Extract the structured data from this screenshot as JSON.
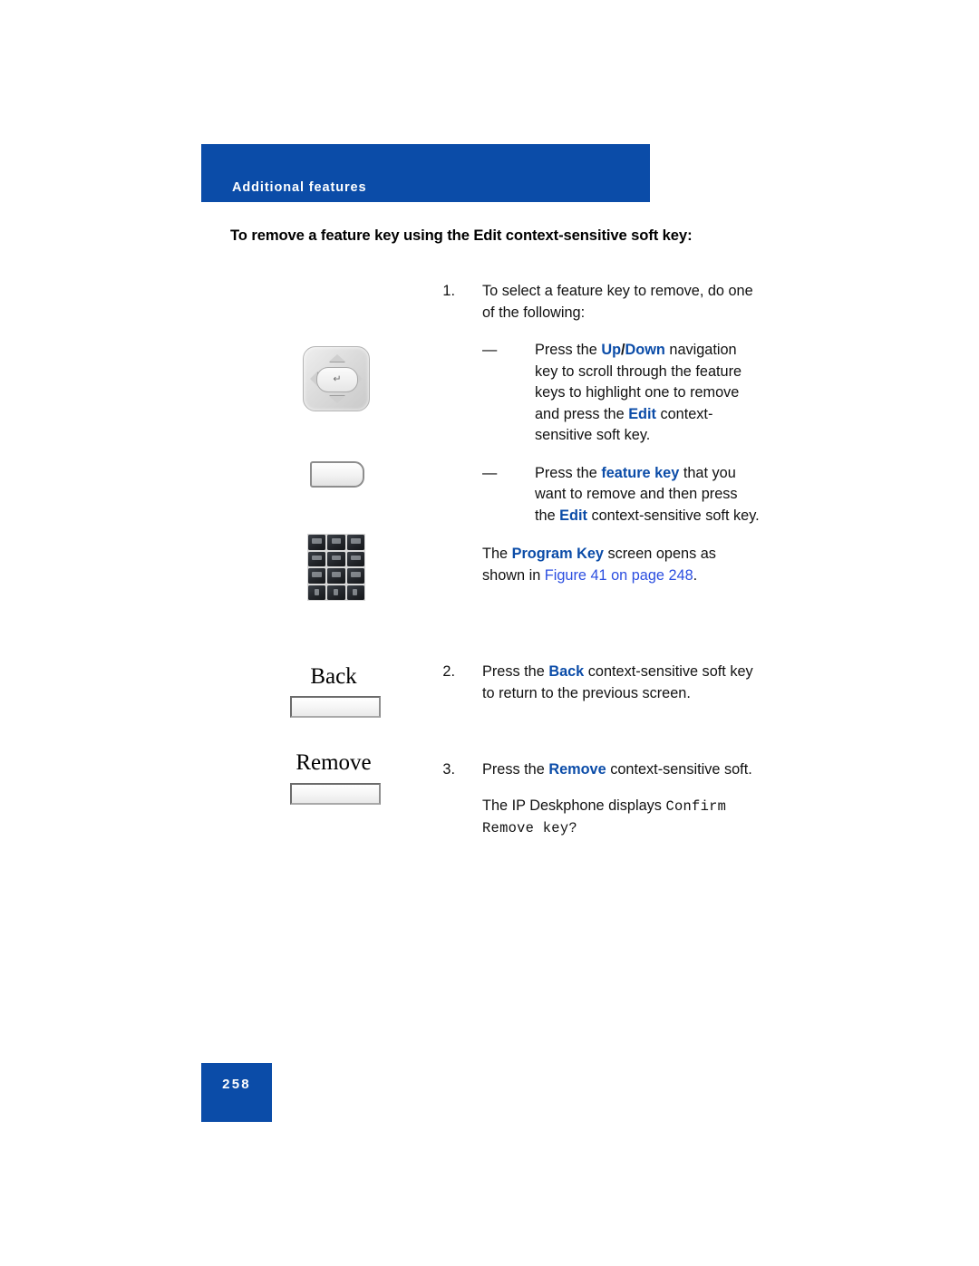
{
  "document": {
    "header_label": "Additional features",
    "page_number": "258",
    "section_heading": "To remove a feature key using the Edit context-sensitive soft key:"
  },
  "colors": {
    "brand_blue": "#0B4CA8",
    "link_blue": "#2b4ee0",
    "text_black": "#111111",
    "header_text": "#ffffff"
  },
  "steps": [
    {
      "number": "1.",
      "text_before": "To select a feature key to remove, do one of the following:",
      "bullets": [
        {
          "dash": "—",
          "part1": "Press the ",
          "bold1": "Up",
          "sep": "/",
          "bold2": "Down",
          "part2": " navigation key to scroll through the feature keys to highlight one to remove and press the ",
          "bold3": "Edit",
          "part3": " context-sensitive soft key."
        },
        {
          "dash": "—",
          "part1": "Press the ",
          "bold1": "feature key",
          "part2": " that you want to remove and then press the ",
          "bold2": "Edit",
          "part3": " context-sensitive soft key."
        }
      ],
      "note": {
        "part1": "The ",
        "bold1": "Program Key",
        "part2": " screen opens as shown in ",
        "link": "Figure 41 on page 248",
        "part3": "."
      }
    },
    {
      "number": "2.",
      "part1": "Press the ",
      "bold1": "Back",
      "part2": " context-sensitive soft key to return to the previous screen."
    },
    {
      "number": "3.",
      "part1": "Press the ",
      "bold1": "Remove",
      "part2": " context-sensitive soft.",
      "note": {
        "part1": "The IP Deskphone displays ",
        "mono": "Confirm Remove key?"
      }
    }
  ],
  "graphics": {
    "navigation_key": {
      "name": "navigation-cluster",
      "enter_glyph": "↵"
    },
    "soft_key": {
      "name": "context-sensitive-soft-key"
    },
    "dialpad": {
      "name": "dialpad-keys",
      "rows": 4,
      "cols": 3
    },
    "labeled_keys": [
      {
        "caption": "Back"
      },
      {
        "caption": "Remove"
      }
    ]
  }
}
